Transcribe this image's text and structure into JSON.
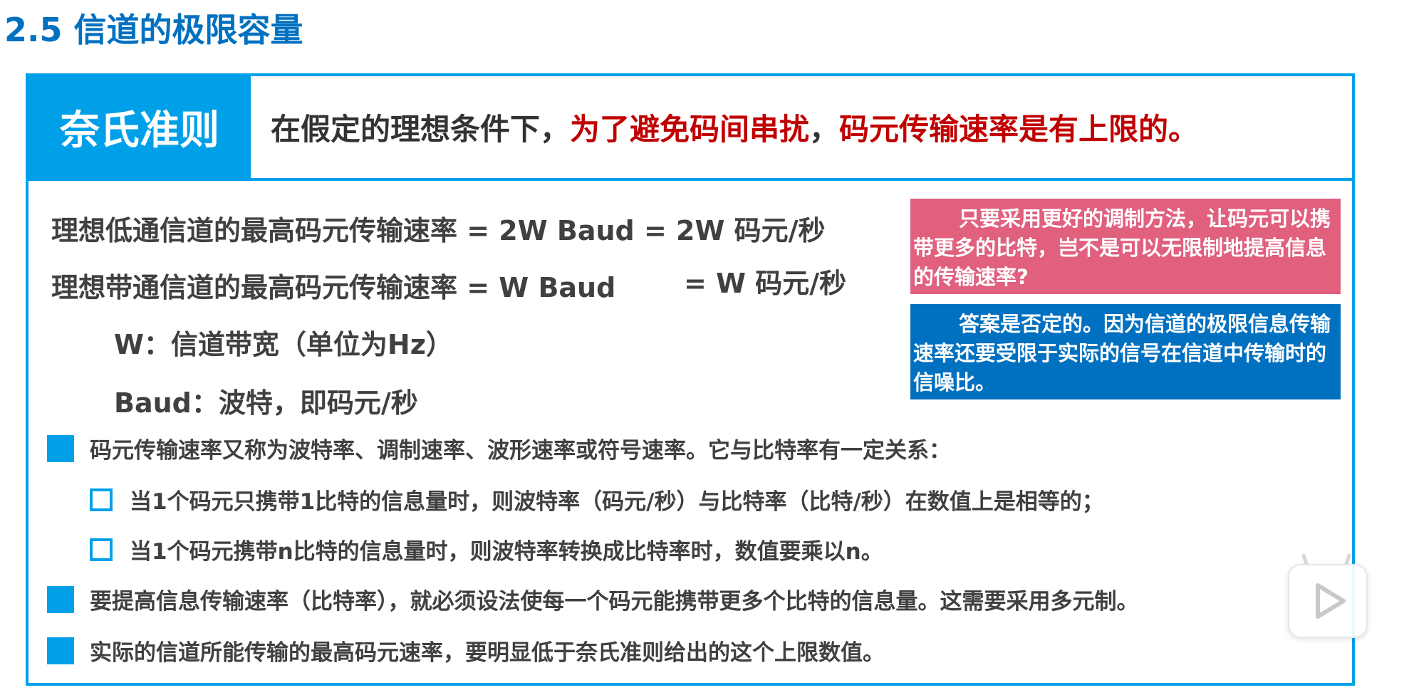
{
  "slide": {
    "title": "2.5 信道的极限容量"
  },
  "header": {
    "label": "奈氏准则",
    "text_part1": "在假定的理想条件下，",
    "text_part2": "为了避免码间串扰",
    "text_part3": "，",
    "text_part4": "码元传输速率是有上限的。"
  },
  "formulas": {
    "lowpass": "理想低通信道的最高码元传输速率 = 2W Baud = 2W 码元/秒",
    "bandpass_a": "理想带通信道的最高码元传输速率 = W Baud",
    "bandpass_b": "= W 码元/秒"
  },
  "definitions": {
    "w": "W：信道带宽（单位为Hz）",
    "baud": "Baud：波特，即码元/秒"
  },
  "notes": {
    "question": "只要采用更好的调制方法，让码元可以携带更多的比特，岂不是可以无限制地提高信息的传输速率?",
    "answer": "答案是否定的。因为信道的极限信息传输速率还要受限于实际的信号在信道中传输时的信噪比。"
  },
  "bullets": [
    "码元传输速率又称为波特率、调制速率、波形速率或符号速率。它与比特率有一定关系：",
    "当1个码元只携带1比特的信息量时，则波特率（码元/秒）与比特率（比特/秒）在数值上是相等的；",
    "当1个码元携带n比特的信息量时，则波特率转换成比特率时，数值要乘以n。",
    "要提高信息传输速率（比特率），就必须设法使每一个码元能携带更多个比特的信息量。这需要采用多元制。",
    "实际的信道所能传输的最高码元速率，要明显低于奈氏准则给出的这个上限数值。"
  ],
  "colors": {
    "accent": "#00a0e9",
    "title_blue": "#0070c0",
    "highlight_red": "#c00000",
    "note_pink": "#e0607e",
    "note_blue": "#0070c0"
  },
  "icons": {
    "play": "play-icon"
  }
}
